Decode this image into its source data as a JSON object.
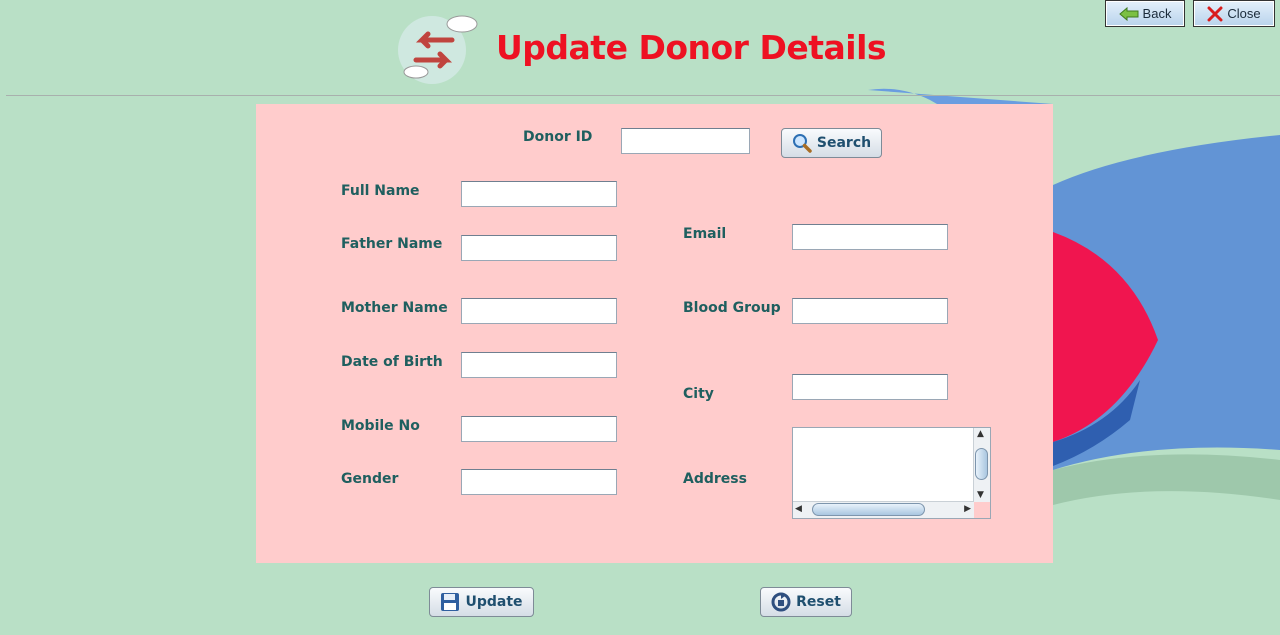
{
  "window": {
    "back_label": "Back",
    "close_label": "Close"
  },
  "header": {
    "title": "Update Donor Details"
  },
  "search": {
    "donor_id_label": "Donor ID",
    "donor_id_value": "",
    "search_label": "Search"
  },
  "form": {
    "full_name_label": "Full Name",
    "full_name_value": "",
    "father_name_label": "Father Name",
    "father_name_value": "",
    "mother_name_label": "Mother Name",
    "mother_name_value": "",
    "dob_label": "Date of Birth",
    "dob_value": "",
    "mobile_label": "Mobile No",
    "mobile_value": "",
    "gender_label": "Gender",
    "gender_value": "",
    "email_label": "Email",
    "email_value": "",
    "blood_group_label": "Blood Group",
    "blood_group_value": "",
    "city_label": "City",
    "city_value": "",
    "address_label": "Address",
    "address_value": ""
  },
  "actions": {
    "update_label": "Update",
    "reset_label": "Reset"
  },
  "colors": {
    "background": "#b9e0c6",
    "panel": "#ffcccc",
    "title": "#ee1122",
    "label": "#1f5f5f"
  },
  "icons": {
    "back": "back-arrow-icon",
    "close": "close-x-icon",
    "logo": "update-sync-icon",
    "search": "magnifier-icon",
    "update": "floppy-disk-icon",
    "reset": "reset-icon"
  }
}
